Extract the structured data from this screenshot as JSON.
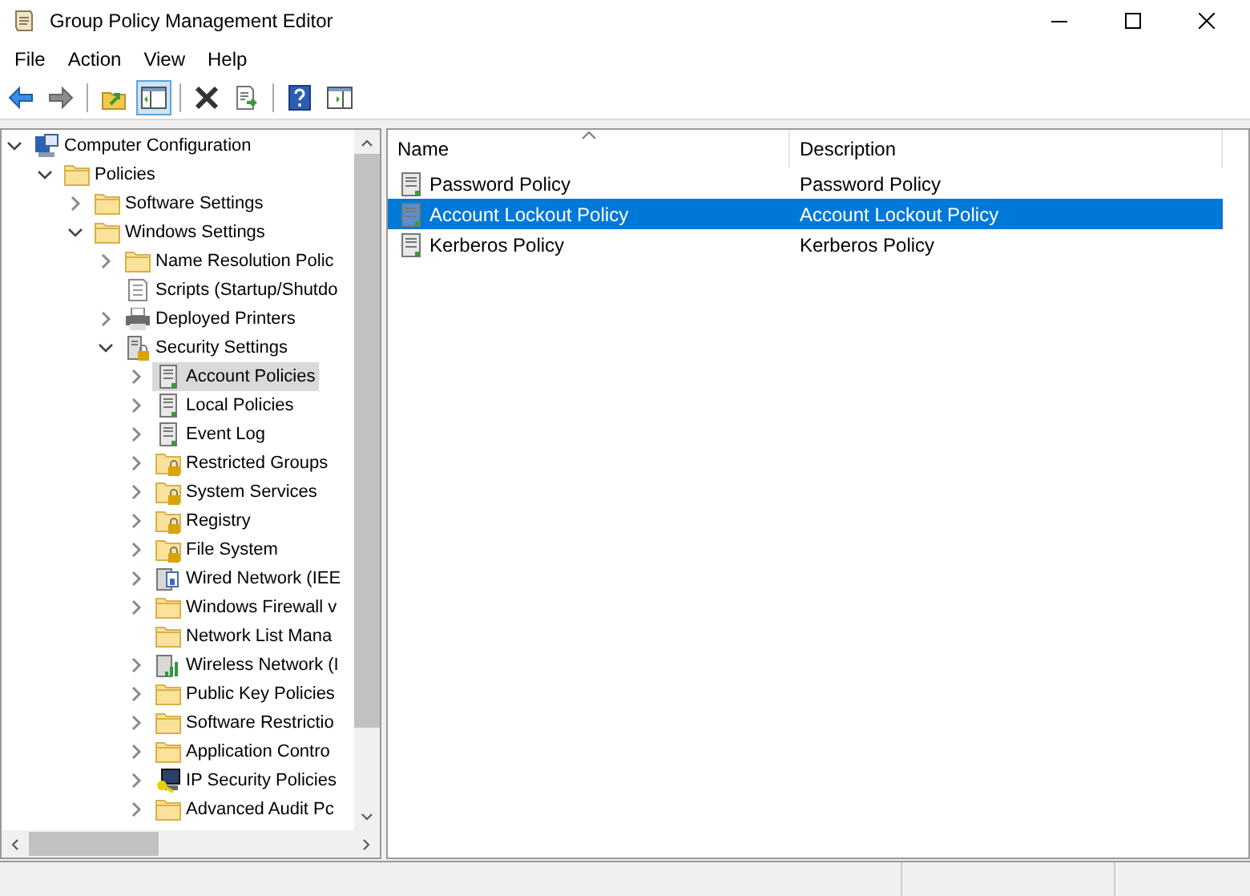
{
  "window": {
    "title": "Group Policy Management Editor"
  },
  "menu": [
    "File",
    "Action",
    "View",
    "Help"
  ],
  "toolbar": [
    {
      "buttons": [
        {
          "kind": "back",
          "pressed": false
        },
        {
          "kind": "forward",
          "pressed": false
        }
      ]
    },
    {
      "buttons": [
        {
          "kind": "up",
          "pressed": false
        },
        {
          "kind": "tree",
          "pressed": true
        }
      ]
    },
    {
      "buttons": [
        {
          "kind": "delete",
          "pressed": false
        },
        {
          "kind": "export",
          "pressed": false
        }
      ]
    },
    {
      "buttons": [
        {
          "kind": "help",
          "pressed": false
        },
        {
          "kind": "pane",
          "pressed": false
        }
      ]
    }
  ],
  "tree": [
    {
      "label": "Computer Configuration",
      "kind": "computer",
      "expandable": true,
      "expanded": true,
      "selected": false,
      "children": [
        {
          "label": "Policies",
          "kind": "folder",
          "expandable": true,
          "expanded": true,
          "selected": false,
          "children": [
            {
              "label": "Software Settings",
              "kind": "folder",
              "expandable": true,
              "expanded": false,
              "selected": false
            },
            {
              "label": "Windows Settings",
              "kind": "folder",
              "expandable": true,
              "expanded": true,
              "selected": false,
              "children": [
                {
                  "label": "Name Resolution Polic",
                  "kind": "folder",
                  "expandable": true,
                  "expanded": false,
                  "selected": false
                },
                {
                  "label": "Scripts (Startup/Shutdo",
                  "kind": "script",
                  "expandable": false,
                  "selected": false
                },
                {
                  "label": "Deployed Printers",
                  "kind": "printer",
                  "expandable": true,
                  "expanded": false,
                  "selected": false
                },
                {
                  "label": "Security Settings",
                  "kind": "security",
                  "expandable": true,
                  "expanded": true,
                  "selected": false,
                  "children": [
                    {
                      "label": "Account Policies",
                      "kind": "policy",
                      "expandable": true,
                      "expanded": false,
                      "selected": true
                    },
                    {
                      "label": "Local Policies",
                      "kind": "policy",
                      "expandable": true,
                      "expanded": false,
                      "selected": false
                    },
                    {
                      "label": "Event Log",
                      "kind": "policy",
                      "expandable": true,
                      "expanded": false,
                      "selected": false
                    },
                    {
                      "label": "Restricted Groups",
                      "kind": "locked",
                      "expandable": true,
                      "expanded": false,
                      "selected": false
                    },
                    {
                      "label": "System Services",
                      "kind": "locked",
                      "expandable": true,
                      "expanded": false,
                      "selected": false
                    },
                    {
                      "label": "Registry",
                      "kind": "locked",
                      "expandable": true,
                      "expanded": false,
                      "selected": false
                    },
                    {
                      "label": "File System",
                      "kind": "locked",
                      "expandable": true,
                      "expanded": false,
                      "selected": false
                    },
                    {
                      "label": "Wired Network (IEE",
                      "kind": "network",
                      "expandable": true,
                      "expanded": false,
                      "selected": false
                    },
                    {
                      "label": "Windows Firewall v",
                      "kind": "folder",
                      "expandable": true,
                      "expanded": false,
                      "selected": false
                    },
                    {
                      "label": "Network List Mana",
                      "kind": "folder",
                      "expandable": false,
                      "selected": false
                    },
                    {
                      "label": "Wireless Network (I",
                      "kind": "wireless",
                      "expandable": true,
                      "expanded": false,
                      "selected": false
                    },
                    {
                      "label": "Public Key Policies",
                      "kind": "folder",
                      "expandable": true,
                      "expanded": false,
                      "selected": false
                    },
                    {
                      "label": "Software Restrictio",
                      "kind": "folder",
                      "expandable": true,
                      "expanded": false,
                      "selected": false
                    },
                    {
                      "label": "Application Contro",
                      "kind": "folder",
                      "expandable": true,
                      "expanded": false,
                      "selected": false
                    },
                    {
                      "label": "IP Security Policies",
                      "kind": "ipsec",
                      "expandable": true,
                      "expanded": false,
                      "selected": false
                    },
                    {
                      "label": "Advanced Audit Pc",
                      "kind": "folder",
                      "expandable": true,
                      "expanded": false,
                      "selected": false
                    }
                  ]
                }
              ]
            }
          ]
        }
      ]
    }
  ],
  "list": {
    "columns": [
      "Name",
      "Description"
    ],
    "rows": [
      {
        "name": "Password Policy",
        "description": "Password Policy",
        "selected": false
      },
      {
        "name": "Account Lockout Policy",
        "description": "Account Lockout Policy",
        "selected": true
      },
      {
        "name": "Kerberos Policy",
        "description": "Kerberos Policy",
        "selected": false
      }
    ]
  }
}
